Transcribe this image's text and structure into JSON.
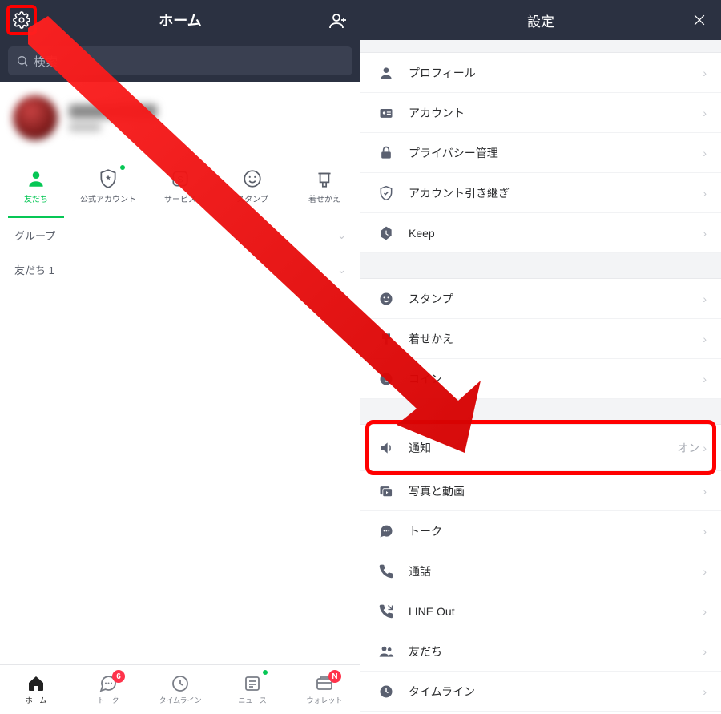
{
  "left": {
    "title": "ホーム",
    "search_placeholder": "検索",
    "cats": [
      {
        "label": "友だち"
      },
      {
        "label": "公式アカウント"
      },
      {
        "label": "サービス"
      },
      {
        "label": "スタンプ"
      },
      {
        "label": "着せかえ"
      }
    ],
    "rows": {
      "group": "グループ",
      "friends": "友だち 1"
    },
    "bottom": [
      {
        "label": "ホーム"
      },
      {
        "label": "トーク",
        "badge": "6"
      },
      {
        "label": "タイムライン"
      },
      {
        "label": "ニュース"
      },
      {
        "label": "ウォレット",
        "badge": "N"
      }
    ]
  },
  "right": {
    "title": "設定",
    "group1": [
      {
        "label": "プロフィール"
      },
      {
        "label": "アカウント"
      },
      {
        "label": "プライバシー管理"
      },
      {
        "label": "アカウント引き継ぎ"
      },
      {
        "label": "Keep"
      }
    ],
    "group2": [
      {
        "label": "スタンプ"
      },
      {
        "label": "着せかえ"
      },
      {
        "label": "コイン"
      }
    ],
    "group3": [
      {
        "label": "通知",
        "value": "オン"
      },
      {
        "label": "写真と動画"
      },
      {
        "label": "トーク"
      },
      {
        "label": "通話"
      },
      {
        "label": "LINE Out"
      },
      {
        "label": "友だち"
      },
      {
        "label": "タイムライン"
      }
    ]
  }
}
